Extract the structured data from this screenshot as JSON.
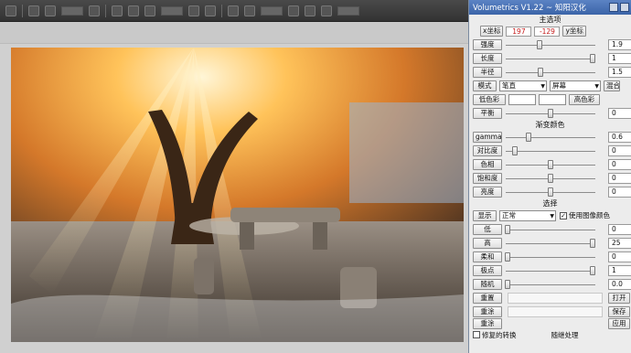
{
  "plugin": {
    "title": "Volumetrics  V1.22 ~ 知阳汉化",
    "sections": {
      "main": "主选项",
      "gradient": "渐变颜色",
      "select": "选择"
    },
    "coords": {
      "x_label": "x坐标",
      "x": "197",
      "y": "-129",
      "y_label": "y坐标"
    },
    "main_sliders": [
      {
        "label": "强度",
        "value": "1.9",
        "pos": 0.38
      },
      {
        "label": "长度",
        "value": "1",
        "pos": 0.97
      },
      {
        "label": "半径",
        "value": "1.5",
        "pos": 0.39
      }
    ],
    "mode": {
      "label": "模式",
      "value1": "笔直",
      "value2": "屏幕",
      "extra": "混合"
    },
    "colors": {
      "low_label": "低色彩",
      "high_label": "高色彩"
    },
    "balance": {
      "label": "平衡",
      "value": "0",
      "pos": 0.5
    },
    "gradient_sliders": [
      {
        "label": "gamma",
        "value": "0.6",
        "pos": 0.26
      },
      {
        "label": "对比度",
        "value": "0",
        "pos": 0.1
      },
      {
        "label": "色相",
        "value": "0",
        "pos": 0.5
      },
      {
        "label": "饱和度",
        "value": "0",
        "pos": 0.5
      },
      {
        "label": "亮度",
        "value": "0",
        "pos": 0.5
      }
    ],
    "display": {
      "label": "显示",
      "value": "正常",
      "checkbox": "使用图像颜色",
      "checked": true
    },
    "select_sliders": [
      {
        "label": "低",
        "value": "0",
        "pos": 0.02
      },
      {
        "label": "高",
        "value": "25",
        "pos": 0.97
      },
      {
        "label": "柔和",
        "value": "0",
        "pos": 0.02
      },
      {
        "label": "极点",
        "value": "1",
        "pos": 0.97
      }
    ],
    "blur": {
      "label": "随机",
      "value": "0.0",
      "pos": 0.02
    },
    "buttons": {
      "reset": "重置",
      "open": "打开",
      "clear": "重涂",
      "save": "保存",
      "apply": "重涂",
      "cancel": "应用"
    },
    "footer": {
      "fix_label": "修复的转换",
      "process_label": "随继处理"
    }
  },
  "colors": {
    "title_bar": "#4a72b6",
    "accent_red": "#c51a1a"
  }
}
